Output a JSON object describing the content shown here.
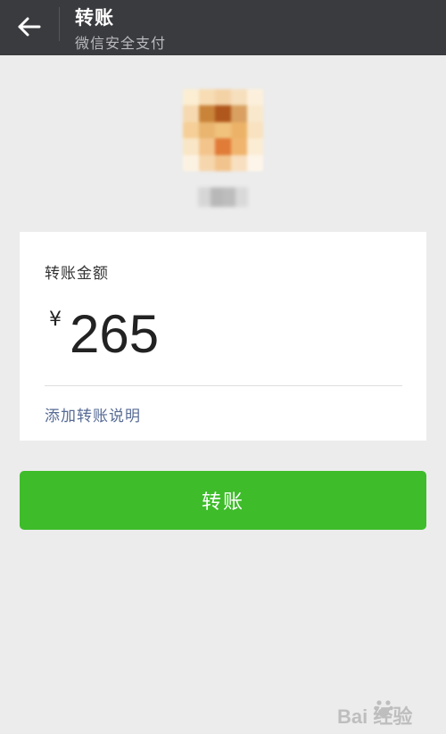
{
  "header": {
    "title": "转账",
    "subtitle": "微信安全支付",
    "back_icon": "arrow-left-icon"
  },
  "card": {
    "amount_label": "转账金额",
    "currency_symbol": "¥",
    "amount": "265",
    "add_note_label": "添加转账说明"
  },
  "action": {
    "transfer_label": "转账"
  },
  "watermark": {
    "text": "Bai 经验"
  },
  "colors": {
    "header_bg": "#3a3b3f",
    "page_bg": "#ececec",
    "button_green": "#3ebc2a",
    "link_blue": "#576b95"
  }
}
